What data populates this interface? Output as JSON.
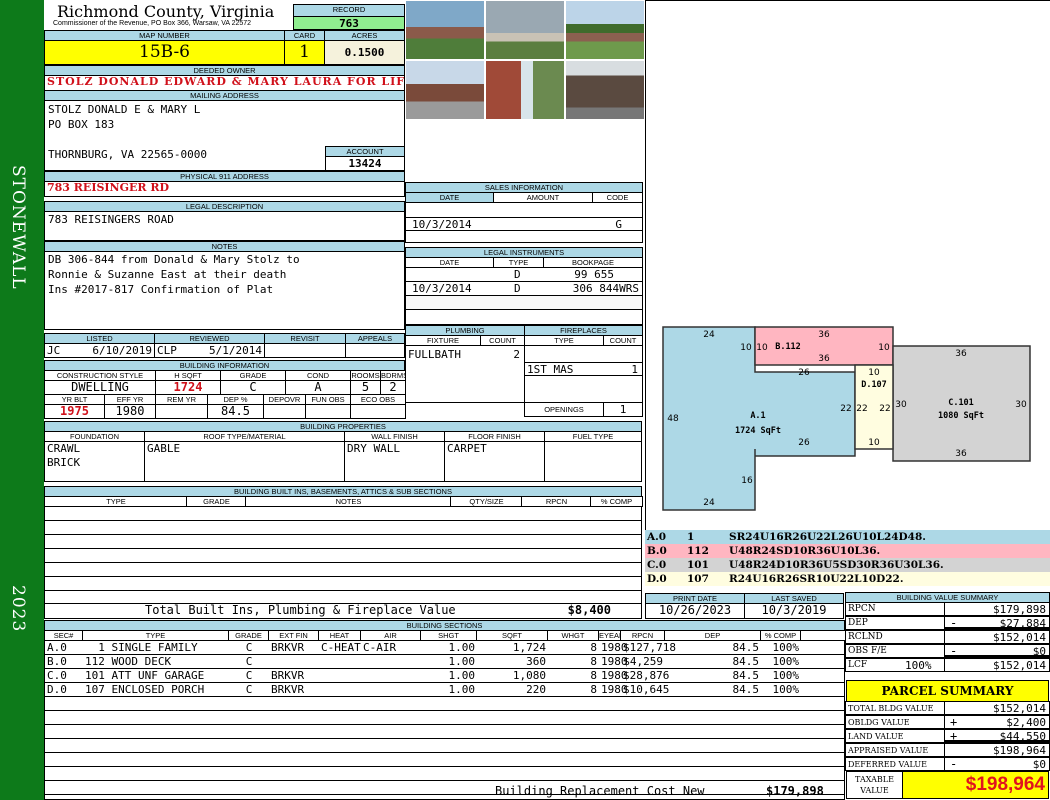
{
  "district": "STONEWALL",
  "year": "2023",
  "header": {
    "county": "Richmond County, Virginia",
    "office": "Commissioner of the Revenue, PO Box 366, Warsaw, VA 22572",
    "record_label": "RECORD",
    "record": "763"
  },
  "parcel": {
    "map_label": "MAP NUMBER",
    "map": "15B-6",
    "card_label": "CARD",
    "card": "1",
    "acres_label": "ACRES",
    "acres": "0.1500"
  },
  "owner": {
    "label": "DEEDED OWNER",
    "name": "STOLZ DONALD EDWARD & MARY LAURA FOR LIFE"
  },
  "mailing": {
    "label": "MAILING ADDRESS",
    "line1": "STOLZ DONALD E & MARY L",
    "line2": "PO BOX 183",
    "line3": "THORNBURG, VA 22565-0000",
    "account_label": "ACCOUNT",
    "account": "13424"
  },
  "physical": {
    "label": "PHYSICAL 911 ADDRESS",
    "value": "783 REISINGER RD"
  },
  "legal": {
    "label": "LEGAL DESCRIPTION",
    "value": "783 REISINGERS ROAD"
  },
  "notes": {
    "label": "NOTES",
    "lines": [
      "DB 306-844 from Donald & Mary Stolz to",
      "Ronnie & Suzanne East at their death",
      "Ins #2017-817 Confirmation of Plat"
    ]
  },
  "review": {
    "headers": [
      "LISTED",
      "REVIEWED",
      "REVISIT",
      "APPEALS"
    ],
    "listed_by": "JC",
    "listed_date": "6/10/2019",
    "reviewed_by": "CLP",
    "reviewed_date": "5/1/2014"
  },
  "building_info": {
    "label": "BUILDING INFORMATION",
    "headers1": [
      "CONSTRUCTION STYLE",
      "H SQFT",
      "GRADE",
      "COND",
      "ROOMS",
      "BDRMS"
    ],
    "values1": [
      "DWELLING",
      "1724",
      "C",
      "A",
      "5",
      "2"
    ],
    "headers2": [
      "YR BLT",
      "EFF YR",
      "REM YR",
      "DEP %",
      "DEPOVR",
      "FUN OBS",
      "ECO OBS"
    ],
    "values2": [
      "1975",
      "1980",
      "",
      "84.5",
      "",
      "",
      ""
    ]
  },
  "sales": {
    "label": "SALES INFORMATION",
    "headers": [
      "DATE",
      "AMOUNT",
      "CODE"
    ],
    "rows": [
      {
        "date": "10/3/2014",
        "amount": "",
        "code": "G"
      }
    ]
  },
  "instruments": {
    "label": "LEGAL INSTRUMENTS",
    "headers": [
      "DATE",
      "TYPE",
      "BOOKPAGE"
    ],
    "rows": [
      {
        "date": "",
        "type": "D",
        "book": "99 655"
      },
      {
        "date": "10/3/2014",
        "type": "D",
        "book": "306 844WRS"
      }
    ]
  },
  "plumbing": {
    "label": "PLUMBING",
    "headers": [
      "FIXTURE",
      "COUNT"
    ],
    "rows": [
      {
        "fixture": "FULLBATH",
        "count": "2"
      }
    ]
  },
  "fireplaces": {
    "label": "FIREPLACES",
    "headers": [
      "TYPE",
      "COUNT"
    ],
    "rows": [
      {
        "type": "1ST MAS",
        "count": "1"
      }
    ],
    "openings_label": "OPENINGS",
    "openings": "1"
  },
  "properties": {
    "label": "BUILDING PROPERTIES",
    "headers": [
      "FOUNDATION",
      "ROOF TYPE/MATERIAL",
      "WALL FINISH",
      "FLOOR FINISH",
      "FUEL TYPE"
    ],
    "foundation": [
      "CRAWL",
      "BRICK"
    ],
    "roof": "GABLE",
    "wall": "DRY WALL",
    "floor": "CARPET",
    "fuel": ""
  },
  "builtins": {
    "label": "BUILDING BUILT INS, BASEMENTS, ATTICS & SUB SECTIONS",
    "headers": [
      "TYPE",
      "GRADE",
      "NOTES",
      "QTY/SIZE",
      "RPCN",
      "% COMP"
    ],
    "total_label": "Total Built Ins, Plumbing & Fireplace Value",
    "total": "$8,400"
  },
  "dates": {
    "print_label": "PRINT DATE",
    "print": "10/26/2023",
    "saved_label": "LAST SAVED",
    "saved": "10/3/2019"
  },
  "sections": {
    "label": "BUILDING SECTIONS",
    "headers": [
      "SEC#",
      "TYPE",
      "GRADE",
      "EXT FIN",
      "HEAT",
      "AIR",
      "SHGT",
      "SQFT",
      "WHGT",
      "EYEAR",
      "RPCN",
      "DEP",
      "% COMP"
    ],
    "rows": [
      {
        "sec": "A.0",
        "type": "  1 SINGLE FAMILY",
        "grade": "C",
        "ext": "BRKVR",
        "heat": "C-HEAT",
        "air": "C-AIR",
        "shgt": "1.00",
        "sqft": "1,724",
        "whgt": "8",
        "eyear": "1980",
        "rpcn": "$127,718",
        "dep": "84.5",
        "comp": "100%"
      },
      {
        "sec": "B.0",
        "type": "112 WOOD DECK",
        "grade": "C",
        "ext": "",
        "heat": "",
        "air": "",
        "shgt": "1.00",
        "sqft": "360",
        "whgt": "8",
        "eyear": "1980",
        "rpcn": "$4,259",
        "dep": "84.5",
        "comp": "100%"
      },
      {
        "sec": "C.0",
        "type": "101 ATT UNF GARAGE",
        "grade": "C",
        "ext": "BRKVR",
        "heat": "",
        "air": "",
        "shgt": "1.00",
        "sqft": "1,080",
        "whgt": "8",
        "eyear": "1980",
        "rpcn": "$28,876",
        "dep": "84.5",
        "comp": "100%"
      },
      {
        "sec": "D.0",
        "type": "107 ENCLOSED PORCH",
        "grade": "C",
        "ext": "BRKVR",
        "heat": "",
        "air": "",
        "shgt": "1.00",
        "sqft": "220",
        "whgt": "8",
        "eyear": "1980",
        "rpcn": "$10,645",
        "dep": "84.5",
        "comp": "100%"
      }
    ],
    "total_label": "Building Replacement Cost New",
    "total": "$179,898"
  },
  "value_summary": {
    "label": "BUILDING VALUE SUMMARY",
    "rows": [
      {
        "label": "RPCN",
        "sign": "",
        "value": "$179,898"
      },
      {
        "label": "DEP",
        "sign": "-",
        "value": "$27,884"
      },
      {
        "label": "RCLND",
        "sign": "",
        "value": "$152,014"
      },
      {
        "label": "OBS F/E",
        "sign": "-",
        "value": "$0"
      },
      {
        "label": "LCF",
        "pct": "100%",
        "sign": "",
        "value": "$152,014"
      }
    ]
  },
  "parcel_summary": {
    "label": "PARCEL SUMMARY",
    "rows": [
      {
        "label": "TOTAL BLDG VALUE",
        "sign": "",
        "value": "$152,014"
      },
      {
        "label": "OBLDG VALUE",
        "sign": "+",
        "value": "$2,400"
      },
      {
        "label": "LAND VALUE",
        "sign": "+",
        "value": "$44,550"
      },
      {
        "label": "APPRAISED VALUE",
        "sign": "",
        "value": "$198,964"
      },
      {
        "label": "DEFERRED VALUE",
        "sign": "-",
        "value": "$0"
      }
    ],
    "taxable_label": "TAXABLE VALUE",
    "taxable": "$198,964"
  },
  "sketch": {
    "labels": {
      "a": "A.1",
      "a_area": "1724 SqFt",
      "b": "B.112",
      "c": "C.101",
      "c_area": "1080 SqFt",
      "d": "D.107"
    },
    "dims": {
      "a_top": "24",
      "a_left": "48",
      "a_bottom": "24",
      "a_16": "16",
      "a_26a": "26",
      "a_26b": "26",
      "a_10": "10",
      "a_22": "22",
      "b_top": "36",
      "b_bottom": "36",
      "b_left": "10",
      "b_right": "10",
      "c_top": "36",
      "c_bottom": "36",
      "c_left": "30",
      "c_right": "30",
      "d_top": "10",
      "d_bottom": "10",
      "d_right": "22"
    },
    "colors": {
      "a": "#add8e6",
      "b": "#ffb6c1",
      "c": "#d3d3d3",
      "d": "#fffde0"
    },
    "legend": [
      {
        "sec": "A.0",
        "code": "1",
        "path": "SR24U16R26U22L26U10L24D48."
      },
      {
        "sec": "B.0",
        "code": "112",
        "path": "U48R24SD10R36U10L36."
      },
      {
        "sec": "C.0",
        "code": "101",
        "path": "U48R24D10R36U5SD30R36U30L36."
      },
      {
        "sec": "D.0",
        "code": "107",
        "path": "R24U16R26SR10U22L10D22."
      }
    ]
  }
}
